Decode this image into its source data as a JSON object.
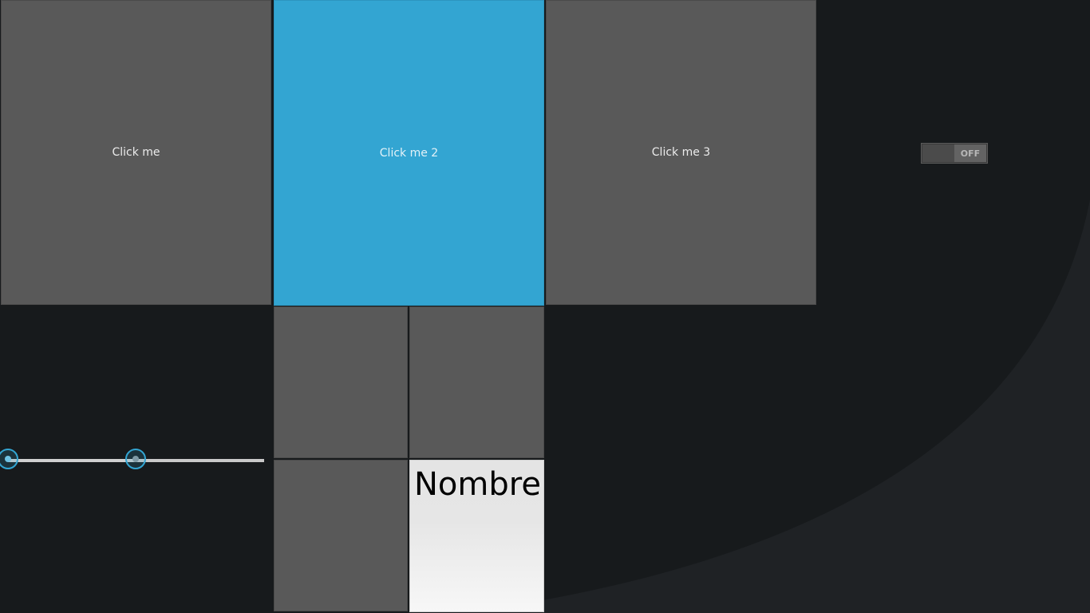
{
  "buttons": {
    "btn1_label": "Click me",
    "btn2_label": "Click me 2",
    "btn3_label": "Click me 3"
  },
  "toggle": {
    "state_label": "OFF",
    "checked": false
  },
  "slider": {
    "min_value": 0,
    "max_value": 50,
    "range": [
      0,
      100
    ]
  },
  "name_input": {
    "value": "Nombre"
  },
  "colors": {
    "background": "#171a1c",
    "tile": "#595959",
    "accent": "#33a5d2",
    "input_background": "#e6e6e6"
  }
}
